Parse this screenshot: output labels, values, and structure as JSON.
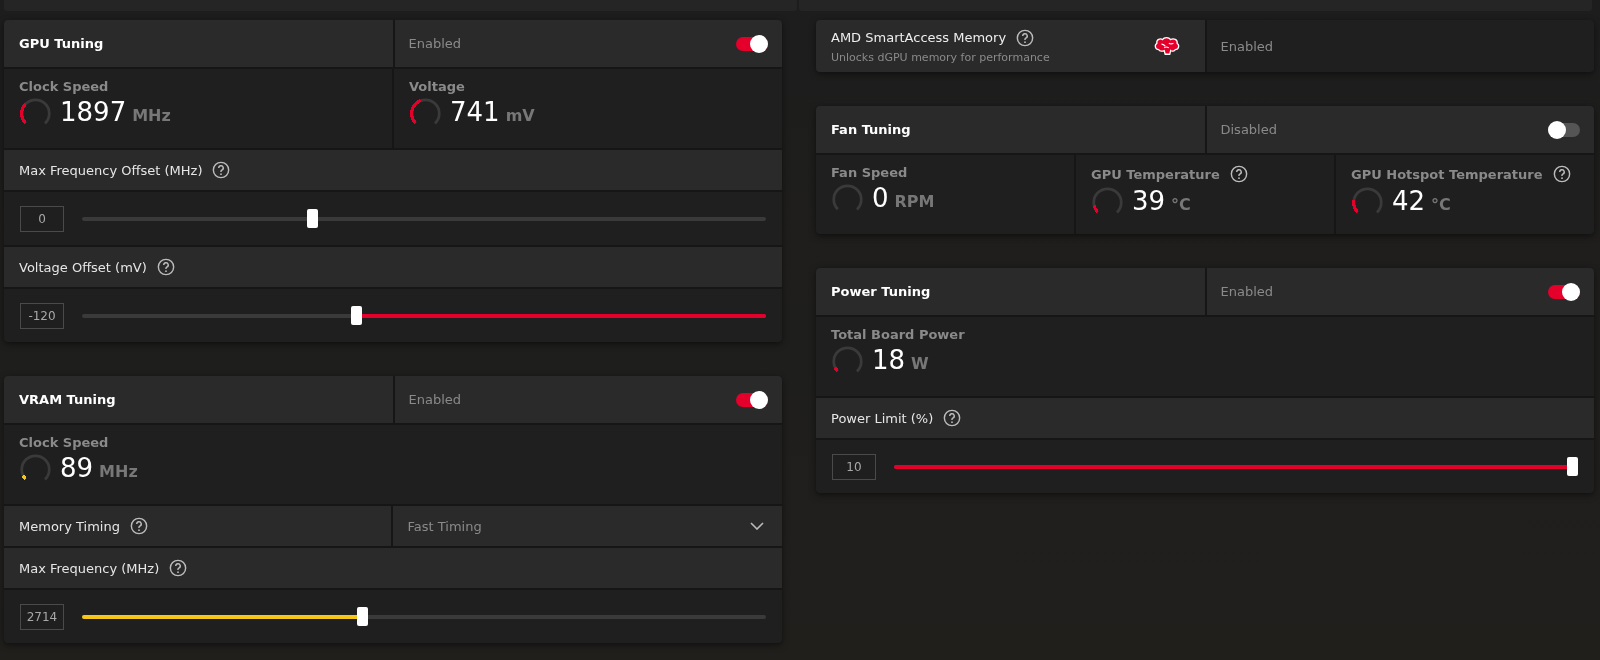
{
  "left_column": [
    {
      "kind": "tuning",
      "title": "GPU Tuning",
      "status": "Enabled",
      "on": true,
      "rows": [
        {
          "kind": "metrics",
          "items": [
            {
              "label": "Clock Speed",
              "help": false,
              "value": "1897",
              "unit": "MHz",
              "level": 0.33,
              "color": "#e4002b"
            },
            {
              "label": "Voltage",
              "help": false,
              "value": "741",
              "unit": "mV",
              "level": 0.42,
              "color": "#e4002b"
            }
          ]
        },
        {
          "kind": "label",
          "text": "Max Frequency Offset (MHz)",
          "help": true
        },
        {
          "kind": "slider",
          "value": "0",
          "level": 0.335,
          "filled_left": false,
          "filled_right": false
        },
        {
          "kind": "label",
          "text": "Voltage Offset (mV)",
          "help": true
        },
        {
          "kind": "slider",
          "value": "-120",
          "level": 0.4,
          "filled_left": false,
          "filled_right": true,
          "color": "#e4002b"
        }
      ]
    },
    {
      "kind": "tuning",
      "title": "VRAM Tuning",
      "status": "Enabled",
      "on": true,
      "rows": [
        {
          "kind": "metrics",
          "items": [
            {
              "label": "Clock Speed",
              "help": false,
              "value": "89",
              "unit": "MHz",
              "level": 0.04,
              "color": "#f5c518"
            }
          ]
        },
        {
          "kind": "dropdown",
          "label": "Memory Timing",
          "help": true,
          "value": "Fast Timing"
        },
        {
          "kind": "label",
          "text": "Max Frequency (MHz)",
          "help": true
        },
        {
          "kind": "slider",
          "value": "2714",
          "level": 0.409,
          "filled_left": true,
          "filled_right": false,
          "color": "#f5c518"
        }
      ]
    }
  ],
  "right_column": [
    {
      "kind": "feature",
      "title": "AMD SmartAccess Memory",
      "help": true,
      "subtitle": "Unlocks dGPU memory for performance",
      "status": "Enabled"
    },
    {
      "kind": "tuning",
      "title": "Fan Tuning",
      "status": "Disabled",
      "on": false,
      "rows": [
        {
          "kind": "metrics",
          "items": [
            {
              "label": "Fan Speed",
              "help": false,
              "value": "0",
              "unit": "RPM",
              "level": 0
            },
            {
              "label": "GPU Temperature",
              "help": true,
              "value": "39",
              "unit": "°C",
              "level": 0.12,
              "color": "#e4002b"
            },
            {
              "label": "GPU Hotspot Temperature",
              "help": true,
              "value": "42",
              "unit": "°C",
              "level": 0.2,
              "color": "#e4002b"
            }
          ]
        }
      ]
    },
    {
      "kind": "tuning",
      "title": "Power Tuning",
      "status": "Enabled",
      "on": true,
      "rows": [
        {
          "kind": "metrics",
          "items": [
            {
              "label": "Total Board Power",
              "help": false,
              "value": "18",
              "unit": "W",
              "level": 0.04,
              "color": "#e4002b"
            }
          ]
        },
        {
          "kind": "label",
          "text": "Power Limit (%)",
          "help": true
        },
        {
          "kind": "slider",
          "value": "10",
          "level": 1,
          "filled_left": true,
          "filled_right": false,
          "color": "#e4002b"
        }
      ]
    }
  ]
}
